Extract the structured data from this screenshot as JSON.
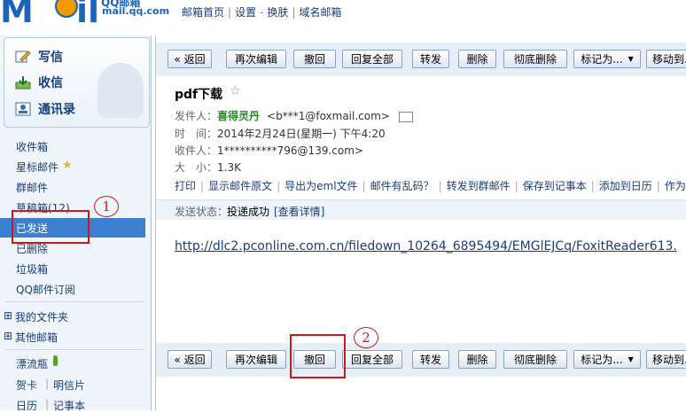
{
  "header": {
    "logo_text_1": "M",
    "logo_text_2": "il",
    "logo_cn": "QQ邮箱",
    "logo_url": "mail.qq.com",
    "nav": [
      "邮箱首页",
      "设置",
      "换肤",
      "域名邮箱"
    ]
  },
  "sidebar": {
    "compose": "写信",
    "inbox_btn": "收信",
    "contacts": "通讯录",
    "folders": [
      "收件箱",
      "星标邮件",
      "群邮件",
      "草稿箱(12)",
      "已发送",
      "已删除",
      "垃圾箱",
      "QQ邮件订阅"
    ],
    "star_icon": "★",
    "my_folders": "我的文件夹",
    "other_mailboxes": "其他邮箱",
    "drift_bottle": "漂流瓶",
    "greeting_card": "贺卡",
    "postcard": "明信片",
    "calendar": "日历",
    "notepad": "记事本",
    "expand_symbol": "⊞",
    "active_folder": "已发送"
  },
  "toolbar": {
    "back": "« 返回",
    "edit_again": "再次编辑",
    "recall": "撤回",
    "reply_all": "全部",
    "reply_all_full": "回复全部",
    "forward": "转发",
    "delete": "删除",
    "delete_permanent": "彻底删除",
    "mark_as": "标记为...",
    "move_to": "移动到..."
  },
  "message": {
    "subject": "pdf下载",
    "star": "☆",
    "from_label": "发件人：",
    "from_name": "喜得灵丹",
    "from_email": "<b***1@foxmail.com>",
    "time_label": "时　间：",
    "time_value": "2014年2月24日(星期一) 下午4:20",
    "to_label": "收件人：",
    "to_value": "1**********796@139.com>",
    "size_label": "大　小：",
    "size_value": "1.3K",
    "actions": [
      "打印",
      "显示邮件原文",
      "导出为eml文件",
      "邮件有乱码？",
      "转发到群邮件",
      "保存到记事本",
      "添加到日历",
      "作为附"
    ],
    "status_label": "发送状态：",
    "status_value": "投递成功",
    "status_link": "[查看详情]",
    "body_link": "http://dlc2.pconline.com.cn/filedown_10264_6895494/EMGlEJCq/FoxitReader613."
  },
  "annotations": {
    "circle_1": "1",
    "circle_2": "2",
    "highlight_color": "#d01818"
  }
}
